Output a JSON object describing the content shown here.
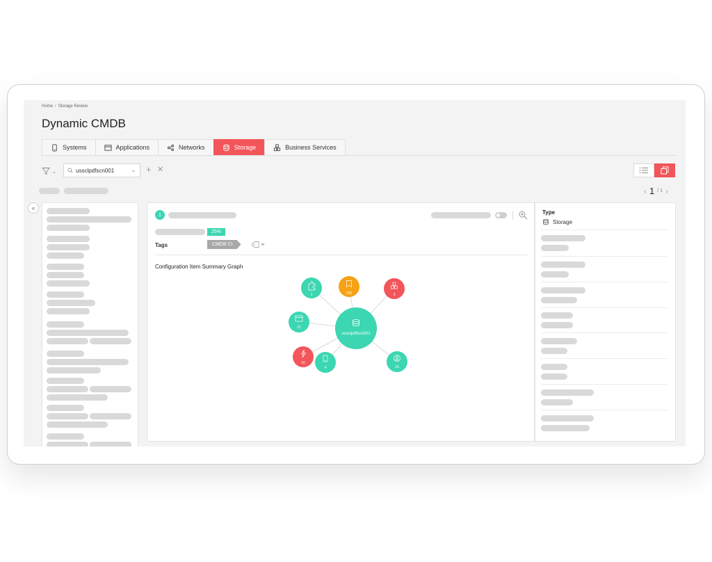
{
  "breadcrumb": {
    "home": "Home",
    "current": "Storage Review"
  },
  "page_title": "Dynamic CMDB",
  "tabs": [
    {
      "label": "Systems",
      "icon": "monitor-icon"
    },
    {
      "label": "Applications",
      "icon": "browser-window-icon"
    },
    {
      "label": "Networks",
      "icon": "share-network-icon"
    },
    {
      "label": "Storage",
      "icon": "database-icon",
      "active": true
    },
    {
      "label": "Business Services",
      "icon": "cubes-icon"
    }
  ],
  "search": {
    "value": "ussclpdfscn001"
  },
  "pager": {
    "current": "1",
    "total": "/ 1"
  },
  "item": {
    "index": "1",
    "progress_label": "25%",
    "progress": 0.25,
    "tags_label": "Tags",
    "tag": "CMDB CI"
  },
  "graph": {
    "title": "Configuration Item Summary Graph",
    "center": {
      "label": "ussclpdfscn001",
      "icon": "database-icon"
    },
    "nodes": [
      {
        "count": "1",
        "icon": "puzzle-icon",
        "color": "#3cd6b2"
      },
      {
        "count": "230",
        "icon": "bookmark-icon",
        "color": "#f5a215"
      },
      {
        "count": "3",
        "icon": "cubes-icon",
        "color": "#f2555a"
      },
      {
        "count": "21",
        "icon": "browser-window-icon",
        "color": "#3cd6b2"
      },
      {
        "count": "16",
        "icon": "lightning-icon",
        "color": "#f2555a"
      },
      {
        "count": "4",
        "icon": "monitor-icon",
        "color": "#3cd6b2"
      },
      {
        "count": "15",
        "icon": "user-circle-icon",
        "color": "#3cd6b2"
      }
    ]
  },
  "details": {
    "type_label": "Type",
    "type_value": "Storage"
  },
  "colors": {
    "accent": "#f2555a",
    "teal": "#3cd6b2",
    "orange": "#f5a215"
  }
}
